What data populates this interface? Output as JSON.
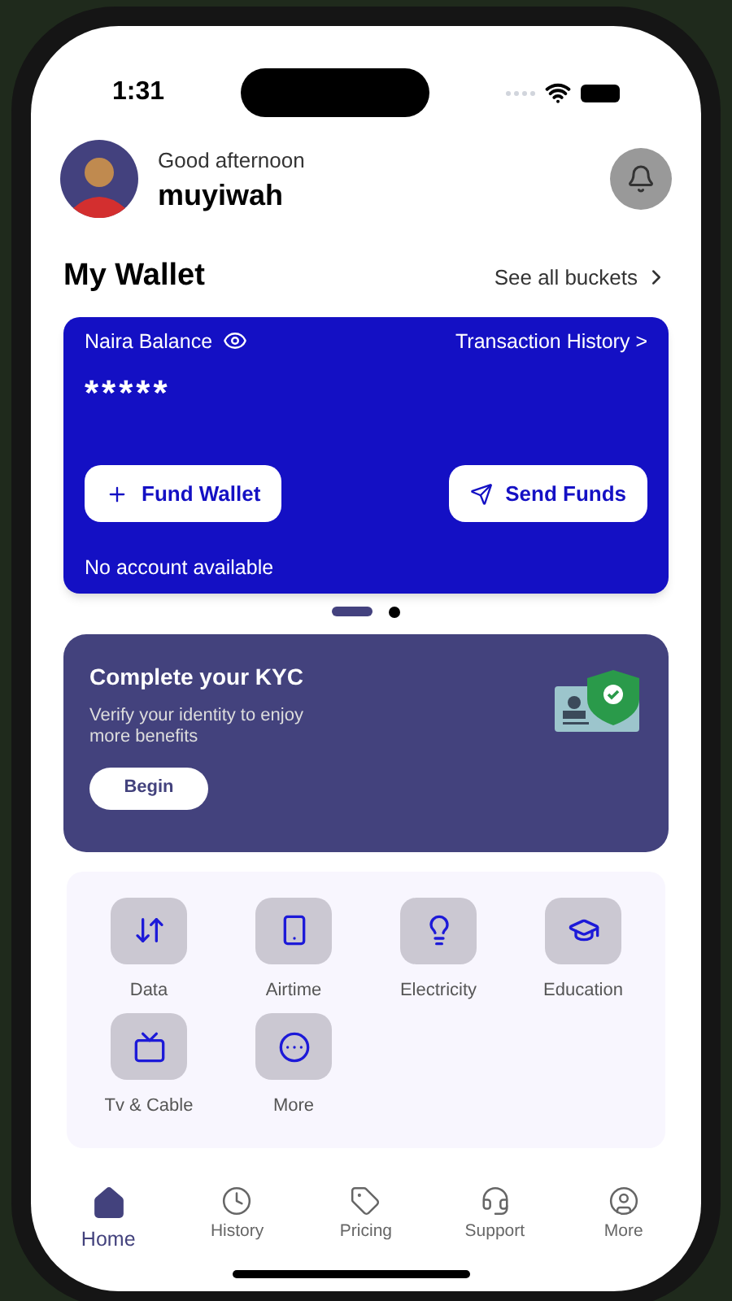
{
  "status_bar": {
    "time": "1:31"
  },
  "header": {
    "greeting": "Good afternoon",
    "username": "muyiwah"
  },
  "wallet": {
    "title": "My Wallet",
    "see_all": "See all buckets",
    "balance_label": "Naira Balance",
    "history_link": "Transaction History >",
    "balance": "*****",
    "buttons": [
      {
        "kind": "fund",
        "label": "Fund Wallet"
      },
      {
        "kind": "send",
        "label": "Send Funds"
      }
    ],
    "account_note": "No account available"
  },
  "carousel_dots": [
    {
      "selected": true
    },
    {
      "selected": false
    }
  ],
  "kyc": {
    "title": "Complete your KYC",
    "text": "Verify your identity to enjoy more benefits",
    "button": "Begin"
  },
  "services": [
    {
      "kind": "data",
      "label": "Data"
    },
    {
      "kind": "airtime",
      "label": "Airtime"
    },
    {
      "kind": "electricity",
      "label": "Electricity"
    },
    {
      "kind": "education",
      "label": "Education"
    },
    {
      "kind": "tv",
      "label": "Tv & Cable"
    },
    {
      "kind": "more",
      "label": "More"
    }
  ],
  "tabs": [
    {
      "kind": "home",
      "label": "Home",
      "selected": true
    },
    {
      "kind": "history",
      "label": "History",
      "selected": false
    },
    {
      "kind": "pricing",
      "label": "Pricing",
      "selected": false
    },
    {
      "kind": "support",
      "label": "Support",
      "selected": false
    },
    {
      "kind": "more",
      "label": "More",
      "selected": false
    }
  ]
}
